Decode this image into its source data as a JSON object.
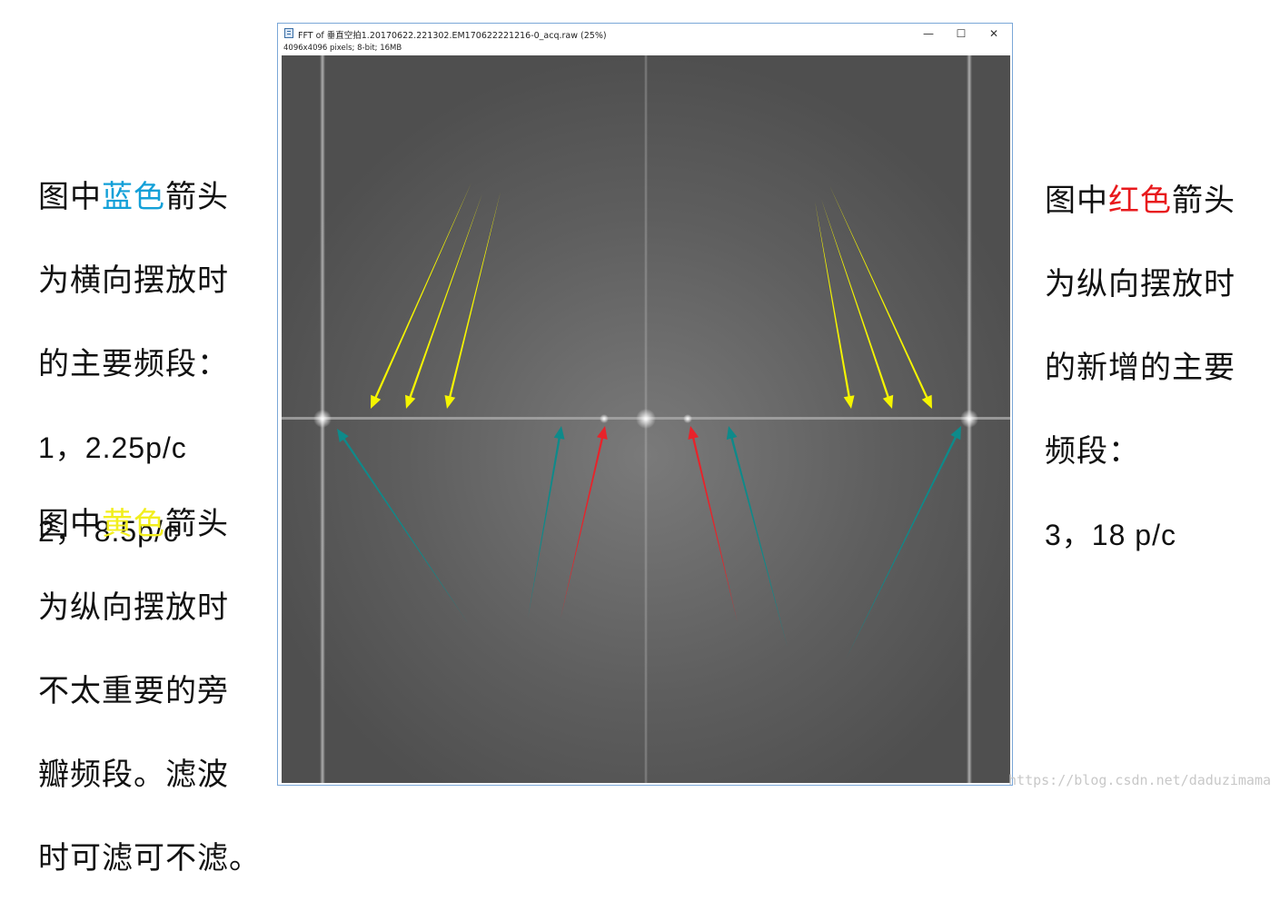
{
  "window": {
    "title": "FFT of 垂直空拍1.20170622.221302.EM170622221216-0_acq.raw (25%)",
    "info": "4096x4096 pixels; 8-bit; 16MB",
    "minimize_glyph": "—",
    "maximize_glyph": "☐",
    "close_glyph": "✕"
  },
  "left_top": {
    "prefix": "图中",
    "highlight": "蓝色",
    "suffix": "箭头",
    "line2": "为横向摆放时",
    "line3": "的主要频段：",
    "line4": "1，2.25p/c",
    "line5": "2， 8.5p/c"
  },
  "left_bottom": {
    "prefix": "图中",
    "highlight": "黄色",
    "suffix": "箭头",
    "line2": "为纵向摆放时",
    "line3": "不太重要的旁",
    "line4": "瓣频段。滤波",
    "line5": "时可滤可不滤。"
  },
  "right_top": {
    "prefix": "图中",
    "highlight": "红色",
    "suffix": "箭头",
    "line2": "为纵向摆放时",
    "line3": "的新增的主要",
    "line4": "频段：",
    "line5": "3，18 p/c"
  },
  "watermark": "https://blog.csdn.net/daduzimama",
  "colors": {
    "blue_text": "#13a0d8",
    "red_text": "#e8191c",
    "yellow_text": "#f2ee1e",
    "arrow_yellow": "#f5f500",
    "arrow_teal": "#0e8a8a",
    "arrow_red": "#e8232a"
  },
  "icons": [
    "imagej-window-icon",
    "minimize-icon",
    "maximize-icon",
    "close-icon",
    "arrow-icon"
  ]
}
